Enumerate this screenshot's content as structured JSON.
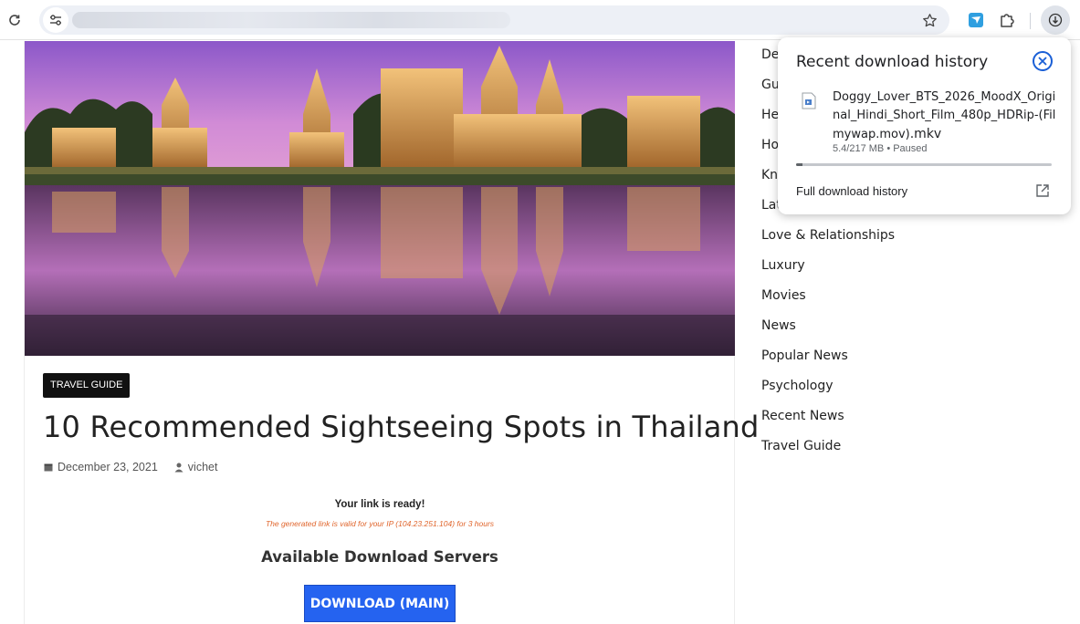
{
  "toolbar": {
    "reload_icon": "reload-icon",
    "site_info_icon": "tune-icon",
    "bookmark_icon": "star-icon",
    "extension_icons": [
      "extension-icon",
      "puzzle-icon"
    ],
    "download_icon": "download-icon"
  },
  "article": {
    "category_tag": "TRAVEL GUIDE",
    "title": "10 Recommended Sightseeing Spots in Thailand",
    "date": "December 23, 2021",
    "author": "vichet",
    "ready_text": "Your link is ready!",
    "valid_text": "The generated link is valid for your IP (104.23.251.104) for 3 hours",
    "servers_heading": "Available Download Servers",
    "download_button": "DOWNLOAD (MAIN)"
  },
  "sidebar": {
    "categories": [
      "De",
      "Gu",
      "He",
      "Ho",
      "Kn",
      "Lat",
      "Love & Relationships",
      "Luxury",
      "Movies",
      "News",
      "Popular News",
      "Psychology",
      "Recent News",
      "Travel Guide"
    ]
  },
  "download_bubble": {
    "title": "Recent download history",
    "file_name": "Doggy_Lover_BTS_2026_MoodX_Original_Hindi_Short_Film_480p_HDRip-(Filmywap.mov)",
    "file_ext": ".mkv",
    "status": "5.4/217 MB • Paused",
    "progress_fraction": 0.025,
    "full_history_label": "Full download history"
  },
  "colors": {
    "accent": "#2563f0",
    "close_ring": "#1a5fd6",
    "status_orange": "#e0652c"
  }
}
